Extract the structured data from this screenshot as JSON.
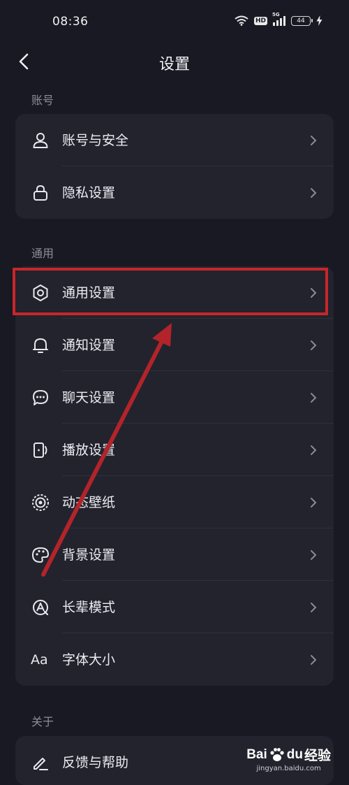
{
  "status_bar": {
    "time": "08:36",
    "hd": "HD",
    "network": "5G",
    "battery": "44"
  },
  "nav": {
    "title": "设置"
  },
  "sections": [
    {
      "label": "账号",
      "items": [
        {
          "label": "账号与安全",
          "icon": "user-icon"
        },
        {
          "label": "隐私设置",
          "icon": "lock-icon"
        }
      ]
    },
    {
      "label": "通用",
      "items": [
        {
          "label": "通用设置",
          "icon": "gear-icon"
        },
        {
          "label": "通知设置",
          "icon": "bell-icon"
        },
        {
          "label": "聊天设置",
          "icon": "chat-bubble-icon"
        },
        {
          "label": "播放设置",
          "icon": "phone-rotate-icon"
        },
        {
          "label": "动态壁纸",
          "icon": "live-wallpaper-icon"
        },
        {
          "label": "背景设置",
          "icon": "palette-icon"
        },
        {
          "label": "长辈模式",
          "icon": "elder-mode-icon"
        },
        {
          "label": "字体大小",
          "icon": "font-size-icon",
          "glyph": "Aa"
        }
      ]
    },
    {
      "label": "关于",
      "items": [
        {
          "label": "反馈与帮助",
          "icon": "pencil-icon"
        }
      ]
    }
  ],
  "annotation": {
    "highlight_color": "#c8262a",
    "arrow_color": "#b2242a"
  },
  "watermark": {
    "brand_left": "Bai",
    "brand_right": "du",
    "brand_cn": "经验",
    "url": "jingyan.baidu.com"
  }
}
